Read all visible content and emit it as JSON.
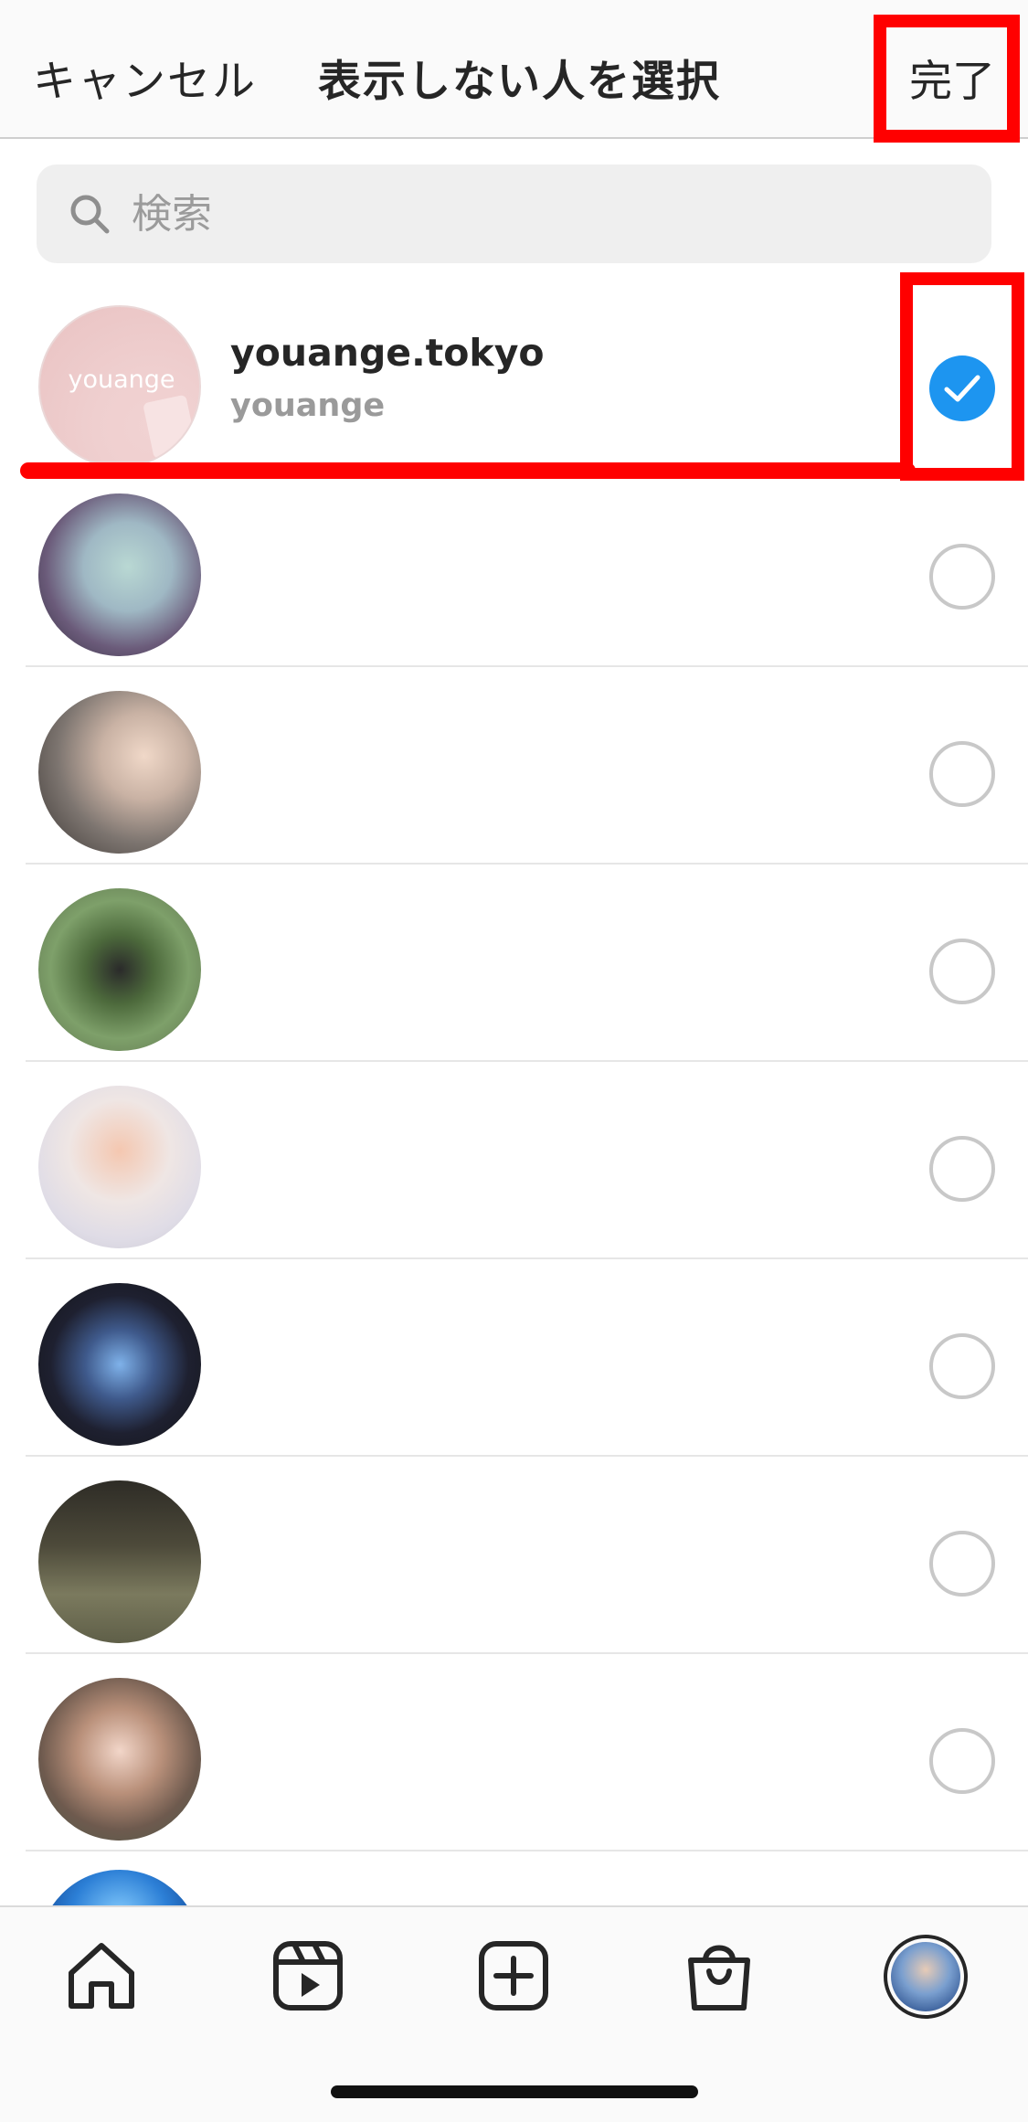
{
  "header": {
    "cancel_label": "キャンセル",
    "title": "表示しない人を選択",
    "done_label": "完了"
  },
  "search": {
    "placeholder": "検索",
    "value": ""
  },
  "accounts": [
    {
      "username": "youange.tokyo",
      "full_name": "youange",
      "avatar_text": "youange",
      "selected": true
    },
    {
      "username": "",
      "full_name": "",
      "selected": false
    },
    {
      "username": "",
      "full_name": "",
      "selected": false
    },
    {
      "username": "",
      "full_name": "",
      "selected": false
    },
    {
      "username": "",
      "full_name": "",
      "selected": false
    },
    {
      "username": "",
      "full_name": "",
      "selected": false
    },
    {
      "username": "",
      "full_name": "",
      "selected": false
    },
    {
      "username": "",
      "full_name": "",
      "selected": false
    }
  ],
  "tabbar": {
    "items": [
      "home-icon",
      "reels-icon",
      "new-post-icon",
      "shop-icon",
      "profile-avatar"
    ]
  },
  "colors": {
    "accent": "#1d95f0",
    "highlight": "#ff0000",
    "text": "#262626",
    "muted": "#9a9a9a"
  }
}
